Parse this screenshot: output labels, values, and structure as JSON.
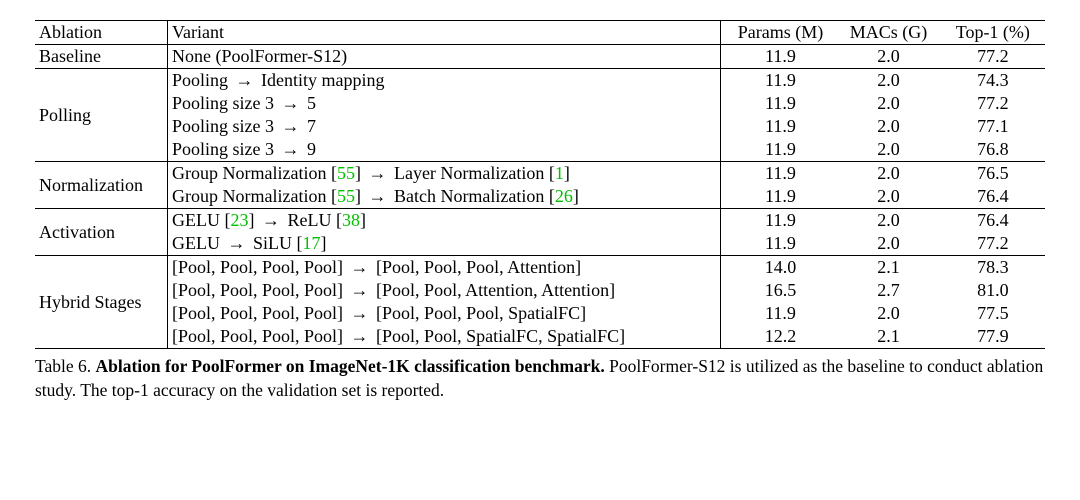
{
  "header": {
    "ablation": "Ablation",
    "variant": "Variant",
    "params": "Params (M)",
    "macs": "MACs (G)",
    "top1": "Top-1 (%)"
  },
  "groups": [
    {
      "label": "Baseline",
      "rows": [
        {
          "variantPlain": "None (PoolFormer-S12)",
          "params": "11.9",
          "macs": "2.0",
          "top1": "77.2"
        }
      ]
    },
    {
      "label": "Polling",
      "rows": [
        {
          "vp": [
            [
              "t",
              "Pooling"
            ],
            [
              "a"
            ],
            [
              "t",
              "Identity mapping"
            ]
          ],
          "params": "11.9",
          "macs": "2.0",
          "top1": "74.3"
        },
        {
          "vp": [
            [
              "t",
              "Pooling size 3"
            ],
            [
              "a"
            ],
            [
              "t",
              "5"
            ]
          ],
          "params": "11.9",
          "macs": "2.0",
          "top1": "77.2"
        },
        {
          "vp": [
            [
              "t",
              "Pooling size 3"
            ],
            [
              "a"
            ],
            [
              "t",
              "7"
            ]
          ],
          "params": "11.9",
          "macs": "2.0",
          "top1": "77.1"
        },
        {
          "vp": [
            [
              "t",
              "Pooling size 3"
            ],
            [
              "a"
            ],
            [
              "t",
              "9"
            ]
          ],
          "params": "11.9",
          "macs": "2.0",
          "top1": "76.8"
        }
      ]
    },
    {
      "label": "Normalization",
      "rows": [
        {
          "vp": [
            [
              "t",
              "Group Normalization ["
            ],
            [
              "c",
              "55"
            ],
            [
              "t",
              "]"
            ],
            [
              "a"
            ],
            [
              "t",
              "Layer Normalization ["
            ],
            [
              "c",
              "1"
            ],
            [
              "t",
              "]"
            ]
          ],
          "params": "11.9",
          "macs": "2.0",
          "top1": "76.5"
        },
        {
          "vp": [
            [
              "t",
              "Group Normalization ["
            ],
            [
              "c",
              "55"
            ],
            [
              "t",
              "]"
            ],
            [
              "a"
            ],
            [
              "t",
              "Batch Normalization ["
            ],
            [
              "c",
              "26"
            ],
            [
              "t",
              "]"
            ]
          ],
          "params": "11.9",
          "macs": "2.0",
          "top1": "76.4"
        }
      ]
    },
    {
      "label": "Activation",
      "rows": [
        {
          "vp": [
            [
              "t",
              "GELU ["
            ],
            [
              "c",
              "23"
            ],
            [
              "t",
              "]"
            ],
            [
              "a"
            ],
            [
              "t",
              "ReLU ["
            ],
            [
              "c",
              "38"
            ],
            [
              "t",
              "]"
            ]
          ],
          "params": "11.9",
          "macs": "2.0",
          "top1": "76.4"
        },
        {
          "vp": [
            [
              "t",
              "GELU"
            ],
            [
              "a"
            ],
            [
              "t",
              "SiLU ["
            ],
            [
              "c",
              "17"
            ],
            [
              "t",
              "]"
            ]
          ],
          "params": "11.9",
          "macs": "2.0",
          "top1": "77.2"
        }
      ]
    },
    {
      "label": "Hybrid Stages",
      "rows": [
        {
          "vp": [
            [
              "t",
              "[Pool, Pool, Pool, Pool]"
            ],
            [
              "a"
            ],
            [
              "t",
              "[Pool, Pool, Pool, Attention]"
            ]
          ],
          "params": "14.0",
          "macs": "2.1",
          "top1": "78.3"
        },
        {
          "vp": [
            [
              "t",
              "[Pool, Pool, Pool, Pool]"
            ],
            [
              "a"
            ],
            [
              "t",
              "[Pool, Pool, Attention, Attention]"
            ]
          ],
          "params": "16.5",
          "macs": "2.7",
          "top1": "81.0"
        },
        {
          "vp": [
            [
              "t",
              "[Pool, Pool, Pool, Pool]"
            ],
            [
              "a"
            ],
            [
              "t",
              "[Pool, Pool, Pool, SpatialFC]"
            ]
          ],
          "params": "11.9",
          "macs": "2.0",
          "top1": "77.5"
        },
        {
          "vp": [
            [
              "t",
              "[Pool, Pool, Pool, Pool]"
            ],
            [
              "a"
            ],
            [
              "t",
              "[Pool, Pool, SpatialFC, SpatialFC]"
            ]
          ],
          "params": "12.2",
          "macs": "2.1",
          "top1": "77.9"
        }
      ]
    }
  ],
  "caption": {
    "lead": "Table 6. ",
    "bold": "Ablation for PoolFormer on ImageNet-1K classification benchmark.",
    "rest": " PoolFormer-S12 is utilized as the baseline to conduct ablation study. The top-1 accuracy on the validation set is reported."
  },
  "arrow": "→"
}
